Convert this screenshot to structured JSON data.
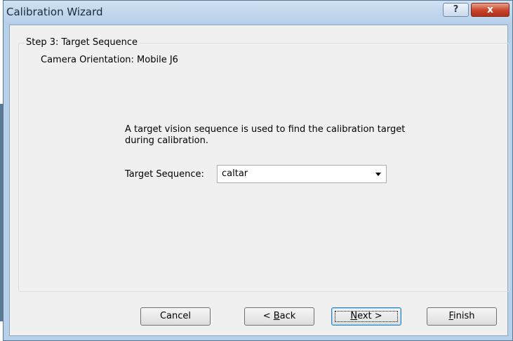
{
  "window": {
    "title": "Calibration Wizard",
    "help_label": "?",
    "close_label": "x"
  },
  "step": {
    "title": "Step 3: Target Sequence",
    "orientation": "Camera Orientation: Mobile J6",
    "description": "A target vision sequence is used to find the calibration target during calibration."
  },
  "form": {
    "sequence_label": "Target Sequence:",
    "sequence_value": "caltar"
  },
  "buttons": {
    "cancel": "Cancel",
    "back_prefix": "< ",
    "back_mnemonic": "B",
    "back_rest": "ack",
    "next_mnemonic": "N",
    "next_rest": "ext >",
    "finish_mnemonic": "F",
    "finish_rest": "inish"
  },
  "colors": {
    "frame": "#b8d1ea",
    "client": "#f0f0f0",
    "close_button": "#c8432a"
  }
}
